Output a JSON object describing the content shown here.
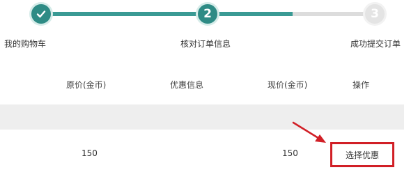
{
  "steps": [
    {
      "label": "我的购物车",
      "number": "",
      "state": "done"
    },
    {
      "label": "核对订单信息",
      "number": "2",
      "state": "current"
    },
    {
      "label": "成功提交订单",
      "number": "3",
      "state": "todo"
    }
  ],
  "table": {
    "headers": [
      "原价(金币)",
      "优惠信息",
      "现价(金币)",
      "操作"
    ],
    "row": {
      "original_price": "150",
      "discount": "",
      "current_price": "150",
      "action": "选择优惠"
    }
  },
  "colors": {
    "accent": "#2e8b85",
    "highlight": "#d11f26"
  }
}
